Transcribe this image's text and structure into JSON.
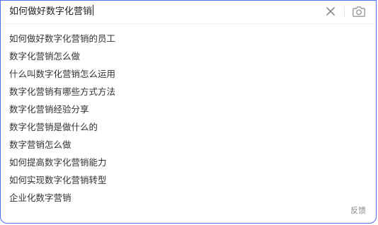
{
  "search": {
    "query": "如何做好数字化营销",
    "clear_icon": "close-icon",
    "camera_icon": "camera-icon"
  },
  "suggestions": [
    {
      "text": "如何做好数字化营销的员工"
    },
    {
      "text": "数字化营销怎么做"
    },
    {
      "text": "什么叫数字化营销怎么运用"
    },
    {
      "text": "数字化营销有哪些方式方法"
    },
    {
      "text": "数字化营销经验分享"
    },
    {
      "text": "数字化营销是做什么的"
    },
    {
      "text": "数字营销怎么做"
    },
    {
      "text": "如何提高数字化营销能力"
    },
    {
      "text": "如何实现数字化营销转型"
    },
    {
      "text": "企业化数字营销"
    }
  ],
  "footer": {
    "feedback_label": "反馈"
  },
  "colors": {
    "border": "#4e6ef2",
    "text": "#333333",
    "muted": "#8a8a8a"
  }
}
